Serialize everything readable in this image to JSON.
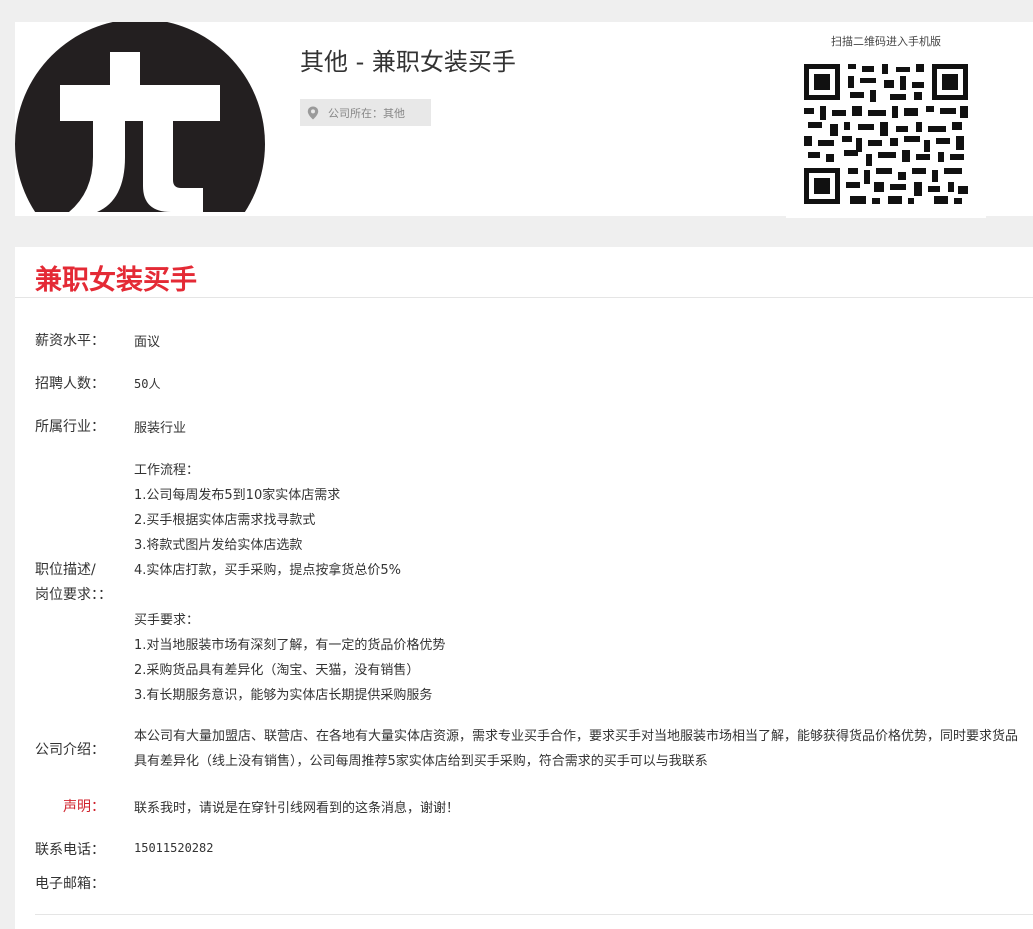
{
  "header": {
    "job_title": "其他 - 兼职女装买手",
    "location_tag": "公司所在：其他",
    "qr_label": "扫描二维码进入手机版"
  },
  "main": {
    "title": "兼职女装买手",
    "fields": {
      "salary_label": "薪资水平：",
      "salary_value": "面议",
      "headcount_label": "招聘人数：",
      "headcount_value": "50人",
      "industry_label": "所属行业：",
      "industry_value": "服装行业",
      "desc_label_1": "职位描述/",
      "desc_label_2": "岗位要求：：",
      "intro_label": "公司介绍：",
      "notice_label": "声明：",
      "notice_value": "联系我时，请说是在穿针引线网看到的这条消息，谢谢！",
      "phone_label": "联系电话：",
      "phone_value": "15011520282",
      "email_label": "电子邮箱："
    },
    "description": [
      "工作流程：",
      "1.公司每周发布5到10家实体店需求",
      "2.买手根据实体店需求找寻款式",
      "3.将款式图片发给实体店选款",
      "4.实体店打款，买手采购，提点按拿货总价5%",
      "",
      "买手要求：",
      "1.对当地服装市场有深刻了解，有一定的货品价格优势",
      "2.采购货品具有差异化（淘宝、天猫，没有销售）",
      "3.有长期服务意识，能够为实体店长期提供采购服务"
    ],
    "company_intro": "本公司有大量加盟店、联营店、在各地有大量实体店资源，需求专业买手合作，要求买手对当地服装市场相当了解，能够获得货品价格优势，同时要求货品具有差异化（线上没有销售），公司每周推荐5家实体店给到买手采购，符合需求的买手可以与我联系"
  }
}
